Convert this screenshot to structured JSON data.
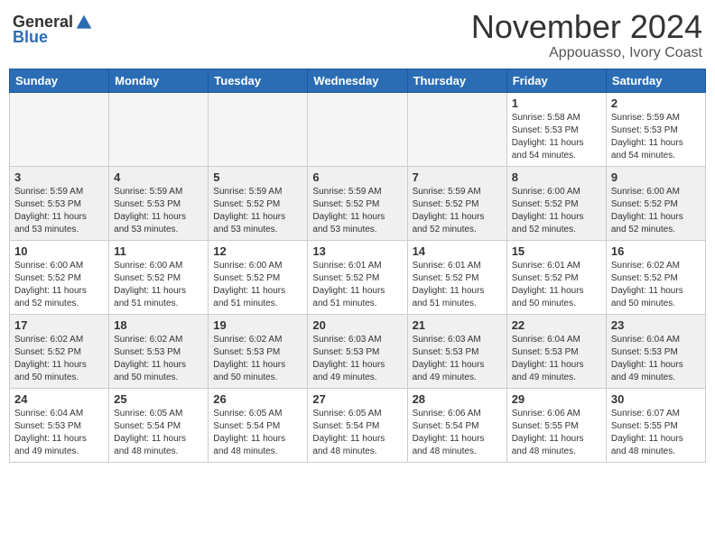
{
  "header": {
    "logo_general": "General",
    "logo_blue": "Blue",
    "month_title": "November 2024",
    "location": "Appouasso, Ivory Coast"
  },
  "weekdays": [
    "Sunday",
    "Monday",
    "Tuesday",
    "Wednesday",
    "Thursday",
    "Friday",
    "Saturday"
  ],
  "weeks": [
    [
      {
        "day": "",
        "info": ""
      },
      {
        "day": "",
        "info": ""
      },
      {
        "day": "",
        "info": ""
      },
      {
        "day": "",
        "info": ""
      },
      {
        "day": "",
        "info": ""
      },
      {
        "day": "1",
        "info": "Sunrise: 5:58 AM\nSunset: 5:53 PM\nDaylight: 11 hours\nand 54 minutes."
      },
      {
        "day": "2",
        "info": "Sunrise: 5:59 AM\nSunset: 5:53 PM\nDaylight: 11 hours\nand 54 minutes."
      }
    ],
    [
      {
        "day": "3",
        "info": "Sunrise: 5:59 AM\nSunset: 5:53 PM\nDaylight: 11 hours\nand 53 minutes."
      },
      {
        "day": "4",
        "info": "Sunrise: 5:59 AM\nSunset: 5:53 PM\nDaylight: 11 hours\nand 53 minutes."
      },
      {
        "day": "5",
        "info": "Sunrise: 5:59 AM\nSunset: 5:52 PM\nDaylight: 11 hours\nand 53 minutes."
      },
      {
        "day": "6",
        "info": "Sunrise: 5:59 AM\nSunset: 5:52 PM\nDaylight: 11 hours\nand 53 minutes."
      },
      {
        "day": "7",
        "info": "Sunrise: 5:59 AM\nSunset: 5:52 PM\nDaylight: 11 hours\nand 52 minutes."
      },
      {
        "day": "8",
        "info": "Sunrise: 6:00 AM\nSunset: 5:52 PM\nDaylight: 11 hours\nand 52 minutes."
      },
      {
        "day": "9",
        "info": "Sunrise: 6:00 AM\nSunset: 5:52 PM\nDaylight: 11 hours\nand 52 minutes."
      }
    ],
    [
      {
        "day": "10",
        "info": "Sunrise: 6:00 AM\nSunset: 5:52 PM\nDaylight: 11 hours\nand 52 minutes."
      },
      {
        "day": "11",
        "info": "Sunrise: 6:00 AM\nSunset: 5:52 PM\nDaylight: 11 hours\nand 51 minutes."
      },
      {
        "day": "12",
        "info": "Sunrise: 6:00 AM\nSunset: 5:52 PM\nDaylight: 11 hours\nand 51 minutes."
      },
      {
        "day": "13",
        "info": "Sunrise: 6:01 AM\nSunset: 5:52 PM\nDaylight: 11 hours\nand 51 minutes."
      },
      {
        "day": "14",
        "info": "Sunrise: 6:01 AM\nSunset: 5:52 PM\nDaylight: 11 hours\nand 51 minutes."
      },
      {
        "day": "15",
        "info": "Sunrise: 6:01 AM\nSunset: 5:52 PM\nDaylight: 11 hours\nand 50 minutes."
      },
      {
        "day": "16",
        "info": "Sunrise: 6:02 AM\nSunset: 5:52 PM\nDaylight: 11 hours\nand 50 minutes."
      }
    ],
    [
      {
        "day": "17",
        "info": "Sunrise: 6:02 AM\nSunset: 5:52 PM\nDaylight: 11 hours\nand 50 minutes."
      },
      {
        "day": "18",
        "info": "Sunrise: 6:02 AM\nSunset: 5:53 PM\nDaylight: 11 hours\nand 50 minutes."
      },
      {
        "day": "19",
        "info": "Sunrise: 6:02 AM\nSunset: 5:53 PM\nDaylight: 11 hours\nand 50 minutes."
      },
      {
        "day": "20",
        "info": "Sunrise: 6:03 AM\nSunset: 5:53 PM\nDaylight: 11 hours\nand 49 minutes."
      },
      {
        "day": "21",
        "info": "Sunrise: 6:03 AM\nSunset: 5:53 PM\nDaylight: 11 hours\nand 49 minutes."
      },
      {
        "day": "22",
        "info": "Sunrise: 6:04 AM\nSunset: 5:53 PM\nDaylight: 11 hours\nand 49 minutes."
      },
      {
        "day": "23",
        "info": "Sunrise: 6:04 AM\nSunset: 5:53 PM\nDaylight: 11 hours\nand 49 minutes."
      }
    ],
    [
      {
        "day": "24",
        "info": "Sunrise: 6:04 AM\nSunset: 5:53 PM\nDaylight: 11 hours\nand 49 minutes."
      },
      {
        "day": "25",
        "info": "Sunrise: 6:05 AM\nSunset: 5:54 PM\nDaylight: 11 hours\nand 48 minutes."
      },
      {
        "day": "26",
        "info": "Sunrise: 6:05 AM\nSunset: 5:54 PM\nDaylight: 11 hours\nand 48 minutes."
      },
      {
        "day": "27",
        "info": "Sunrise: 6:05 AM\nSunset: 5:54 PM\nDaylight: 11 hours\nand 48 minutes."
      },
      {
        "day": "28",
        "info": "Sunrise: 6:06 AM\nSunset: 5:54 PM\nDaylight: 11 hours\nand 48 minutes."
      },
      {
        "day": "29",
        "info": "Sunrise: 6:06 AM\nSunset: 5:55 PM\nDaylight: 11 hours\nand 48 minutes."
      },
      {
        "day": "30",
        "info": "Sunrise: 6:07 AM\nSunset: 5:55 PM\nDaylight: 11 hours\nand 48 minutes."
      }
    ]
  ]
}
